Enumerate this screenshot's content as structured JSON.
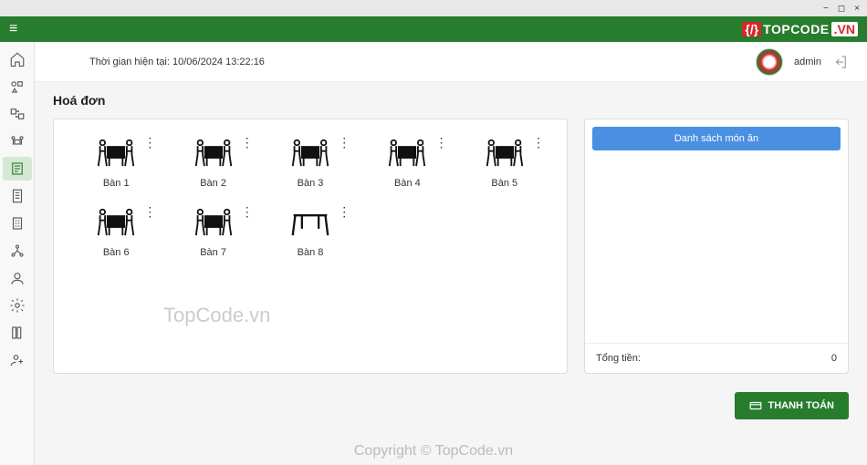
{
  "window": {
    "controls": [
      "−",
      "◻",
      "×"
    ]
  },
  "brand": {
    "bracket": "{/}",
    "name": "TOPCODE",
    "suffix": ".VN"
  },
  "header": {
    "time_prefix": "Thời gian hiện tại: ",
    "time_value": "10/06/2024 13:22:16",
    "username": "admin"
  },
  "page": {
    "title": "Hoá đơn"
  },
  "tables": [
    {
      "label": "Bàn 1",
      "type": "occupied"
    },
    {
      "label": "Bàn 2",
      "type": "occupied"
    },
    {
      "label": "Bàn 3",
      "type": "occupied"
    },
    {
      "label": "Bàn 4",
      "type": "occupied"
    },
    {
      "label": "Bàn 5",
      "type": "occupied"
    },
    {
      "label": "Bàn 6",
      "type": "occupied"
    },
    {
      "label": "Bàn 7",
      "type": "occupied"
    },
    {
      "label": "Bàn 8",
      "type": "empty"
    }
  ],
  "order": {
    "menu_button": "Danh sách món ăn",
    "total_label": "Tổng tiền:",
    "total_value": "0"
  },
  "pay_button": "THANH TOÁN",
  "watermarks": {
    "panel": "TopCode.vn",
    "footer": "Copyright © TopCode.vn"
  }
}
